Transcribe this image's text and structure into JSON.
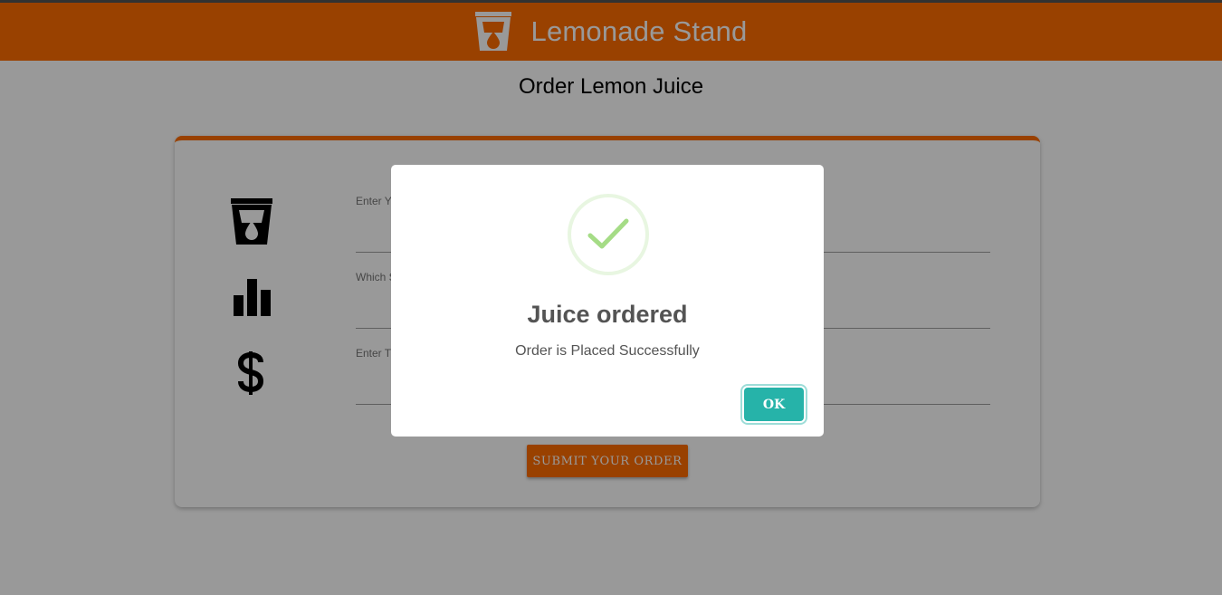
{
  "header": {
    "title": "Lemonade Stand",
    "logo_icon": "cup-drop-icon",
    "color": "#ff6d00"
  },
  "page": {
    "title": "Order Lemon Juice"
  },
  "form": {
    "rows": [
      {
        "icon": "cup-drop-icon",
        "label": "Enter Y"
      },
      {
        "icon": "bar-chart-icon",
        "label": "Which S"
      },
      {
        "icon": "dollar-icon",
        "label": "Enter T"
      }
    ],
    "submit_label": "SUBMIT YOUR ORDER"
  },
  "dialog": {
    "icon": "success-check-icon",
    "title": "Juice ordered",
    "message": "Order is Placed Successfully",
    "ok_label": "OK",
    "ok_color": "#26b3a9",
    "check_color": "#a5dc86"
  }
}
